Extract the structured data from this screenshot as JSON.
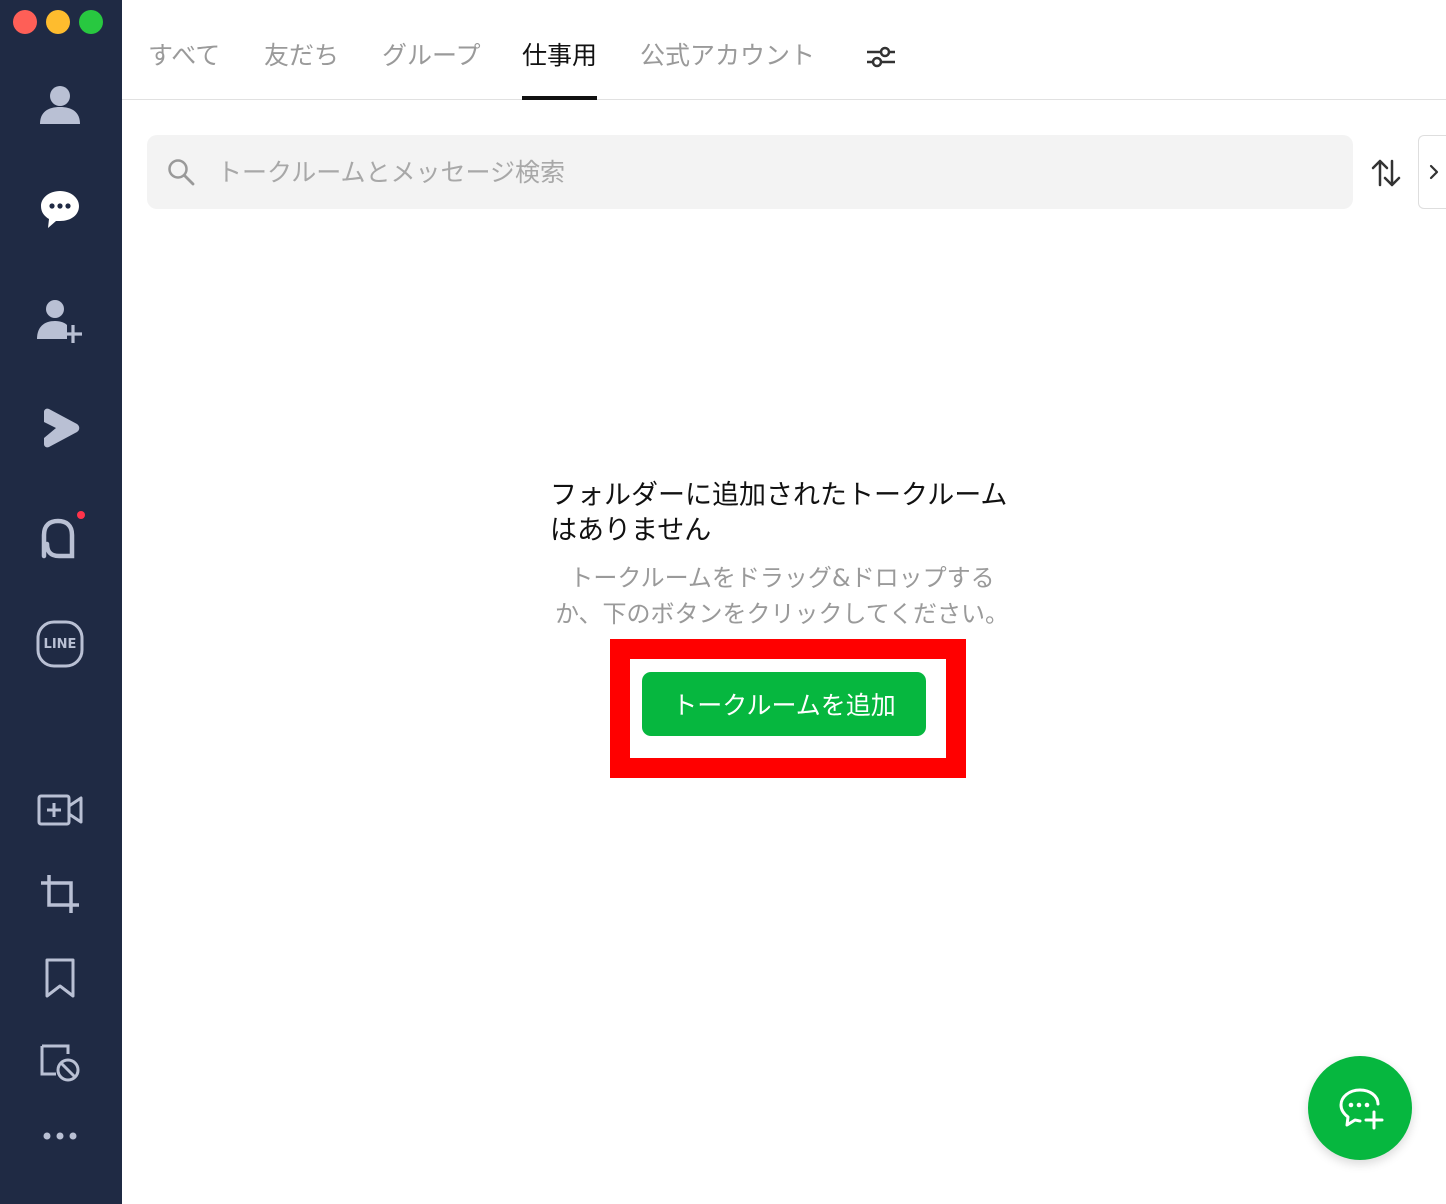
{
  "window": {
    "controls": [
      "close",
      "minimize",
      "zoom"
    ]
  },
  "sidebar": {
    "items": [
      {
        "icon": "person-icon",
        "name": "friends"
      },
      {
        "icon": "chat-bubble-icon",
        "name": "chats",
        "active": true
      },
      {
        "icon": "add-friend-icon",
        "name": "add-friend"
      },
      {
        "icon": "voom-icon",
        "name": "voom"
      },
      {
        "icon": "openchat-icon",
        "name": "openchat",
        "badge": true
      },
      {
        "icon": "line-logo-icon",
        "name": "line-services",
        "logo_text": "LINE"
      },
      {
        "icon": "video-call-icon",
        "name": "video-call"
      },
      {
        "icon": "crop-icon",
        "name": "screenshot"
      },
      {
        "icon": "bookmark-icon",
        "name": "keep"
      },
      {
        "icon": "block-chat-icon",
        "name": "blocked"
      },
      {
        "icon": "more-dots-icon",
        "name": "more"
      }
    ]
  },
  "tabs": {
    "items": [
      {
        "label": "すべて",
        "active": false
      },
      {
        "label": "友だち",
        "active": false
      },
      {
        "label": "グループ",
        "active": false
      },
      {
        "label": "仕事用",
        "active": true
      },
      {
        "label": "公式アカウント",
        "active": false
      }
    ],
    "filter_icon": "sliders-icon"
  },
  "search": {
    "placeholder": "トークルームとメッセージ検索",
    "value": ""
  },
  "empty_state": {
    "title_line1": "フォルダーに追加されたトークルーム",
    "title_line2": "はありません",
    "desc_line1": "トークルームをドラッグ&ドロップする",
    "desc_line2": "か、下のボタンをクリックしてください。",
    "button_label": "トークルームを追加"
  },
  "colors": {
    "sidebar_bg": "#1f2a44",
    "sidebar_icon": "#b9c0d4",
    "accent_green": "#06b73f",
    "highlight_red": "#ff0000",
    "badge_red": "#ff334b"
  }
}
